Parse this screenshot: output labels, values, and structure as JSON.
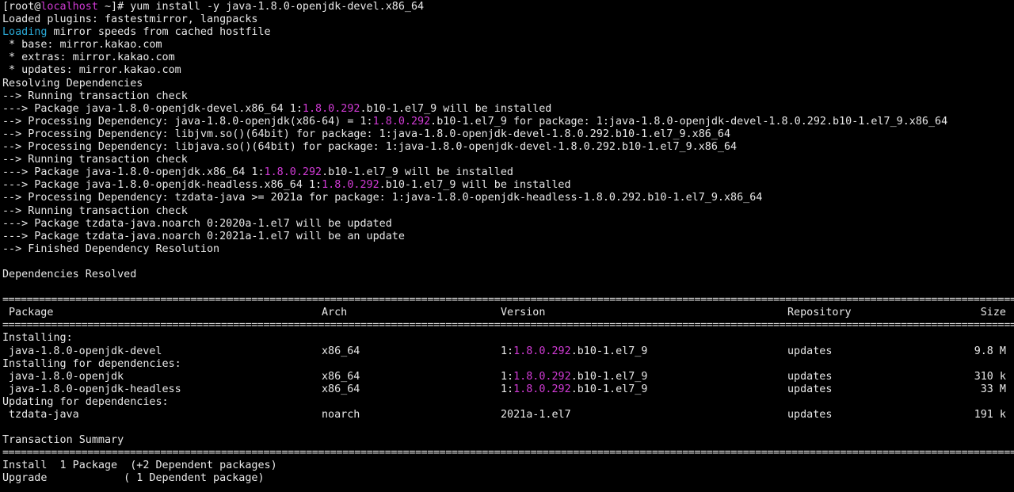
{
  "prompt": {
    "open": "[root@",
    "host": "localhost",
    "rest": " ~]# ",
    "command": "yum install -y java-1.8.0-openjdk-devel.x86_64"
  },
  "log": {
    "plugins": "Loaded plugins: fastestmirror, langpacks",
    "loading_word": "Loading",
    "loading_rest": " mirror speeds from cached hostfile",
    "mirror_base": " * base: mirror.kakao.com",
    "mirror_extras": " * extras: mirror.kakao.com",
    "mirror_updates": " * updates: mirror.kakao.com",
    "resolving": "Resolving Dependencies",
    "check1": "--> Running transaction check",
    "pkg_devel_a": "---> Package java-1.8.0-openjdk-devel.x86_64 1:",
    "pkg_devel_b": ".b10-1.el7_9 will be installed",
    "dep1_a": "--> Processing Dependency: java-1.8.0-openjdk(x86-64) = 1:",
    "dep1_b": ".b10-1.el7_9 for package: 1:java-1.8.0-openjdk-devel-1.8.0.292.b10-1.el7_9.x86_64",
    "dep2": "--> Processing Dependency: libjvm.so()(64bit) for package: 1:java-1.8.0-openjdk-devel-1.8.0.292.b10-1.el7_9.x86_64",
    "dep3": "--> Processing Dependency: libjava.so()(64bit) for package: 1:java-1.8.0-openjdk-devel-1.8.0.292.b10-1.el7_9.x86_64",
    "check2": "--> Running transaction check",
    "pkg_jdk_a": "---> Package java-1.8.0-openjdk.x86_64 1:",
    "pkg_jdk_b": ".b10-1.el7_9 will be installed",
    "pkg_headless_a": "---> Package java-1.8.0-openjdk-headless.x86_64 1:",
    "pkg_headless_b": ".b10-1.el7_9 will be installed",
    "dep4": "--> Processing Dependency: tzdata-java >= 2021a for package: 1:java-1.8.0-openjdk-headless-1.8.0.292.b10-1.el7_9.x86_64",
    "check3": "--> Running transaction check",
    "tz_old": "---> Package tzdata-java.noarch 0:2020a-1.el7 will be updated",
    "tz_new": "---> Package tzdata-java.noarch 0:2021a-1.el7 will be an update",
    "finished": "--> Finished Dependency Resolution",
    "resolved": "Dependencies Resolved"
  },
  "highlight_version": "1.8.0.292",
  "separator": "================================================================================================================================================================================================",
  "table": {
    "headers": {
      "package": "Package",
      "arch": "Arch",
      "version": "Version",
      "repository": "Repository",
      "size": "Size"
    },
    "installing_label": "Installing:",
    "installing": [
      {
        "package": "java-1.8.0-openjdk-devel",
        "arch": "x86_64",
        "ver_prefix": "1:",
        "ver_hl": "1.8.0.292",
        "ver_suffix": ".b10-1.el7_9",
        "repo": "updates",
        "size": "9.8 M"
      }
    ],
    "deps_label": "Installing for dependencies:",
    "deps": [
      {
        "package": "java-1.8.0-openjdk",
        "arch": "x86_64",
        "ver_prefix": "1:",
        "ver_hl": "1.8.0.292",
        "ver_suffix": ".b10-1.el7_9",
        "repo": "updates",
        "size": "310 k"
      },
      {
        "package": "java-1.8.0-openjdk-headless",
        "arch": "x86_64",
        "ver_prefix": "1:",
        "ver_hl": "1.8.0.292",
        "ver_suffix": ".b10-1.el7_9",
        "repo": "updates",
        "size": "33 M"
      }
    ],
    "update_label": "Updating for dependencies:",
    "updates": [
      {
        "package": "tzdata-java",
        "arch": "noarch",
        "version": "2021a-1.el7",
        "repo": "updates",
        "size": "191 k"
      }
    ]
  },
  "summary": {
    "title": "Transaction Summary",
    "install_line": "Install  1 Package  (+2 Dependent packages)",
    "upgrade_line": "Upgrade            ( 1 Dependent package)"
  },
  "colors": {
    "background": "#000000",
    "text": "#e8e8e8",
    "magenta": "#d23bd6",
    "cyan": "#2aa9d6"
  }
}
